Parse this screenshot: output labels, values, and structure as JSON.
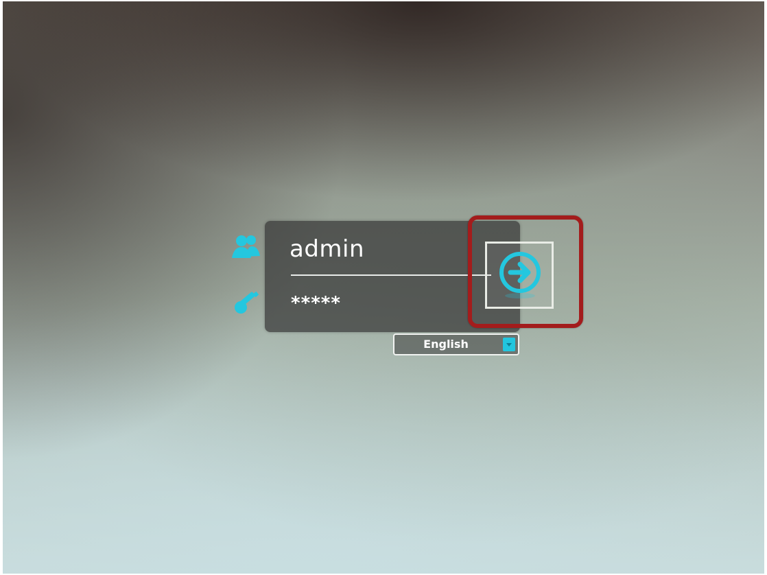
{
  "login": {
    "username": "admin",
    "password_mask": "*****",
    "language": "English"
  },
  "icons": {
    "user": "user-group-icon",
    "password": "key-icon",
    "submit": "arrow-right-circle-icon",
    "dropdown": "chevron-down-icon"
  },
  "colors": {
    "accent": "#22c6de",
    "highlight": "#a31c1c"
  }
}
